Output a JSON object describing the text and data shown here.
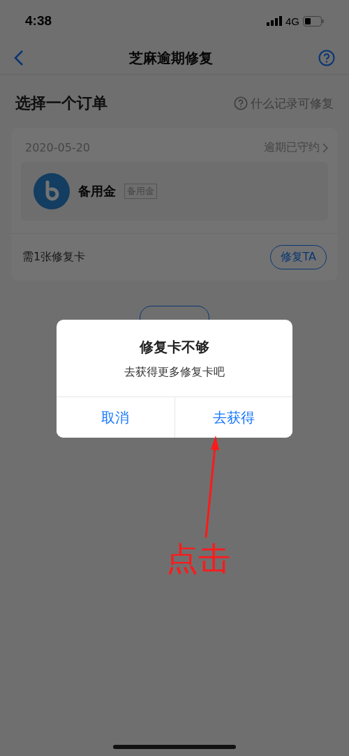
{
  "status_bar": {
    "time": "4:38",
    "network": "4G"
  },
  "nav": {
    "title": "芝麻逾期修复"
  },
  "section": {
    "title": "选择一个订单",
    "help_link": "什么记录可修复"
  },
  "order": {
    "date": "2020-05-20",
    "status": "逾期已守约",
    "product": "备用金",
    "tag": "备用金",
    "requirement": "需1张修复卡",
    "action": "修复TA"
  },
  "dialog": {
    "title": "修复卡不够",
    "message": "去获得更多修复卡吧",
    "buttons": [
      {
        "label": "取消"
      },
      {
        "label": "去获得"
      }
    ]
  },
  "annotation": {
    "text": "点击"
  }
}
